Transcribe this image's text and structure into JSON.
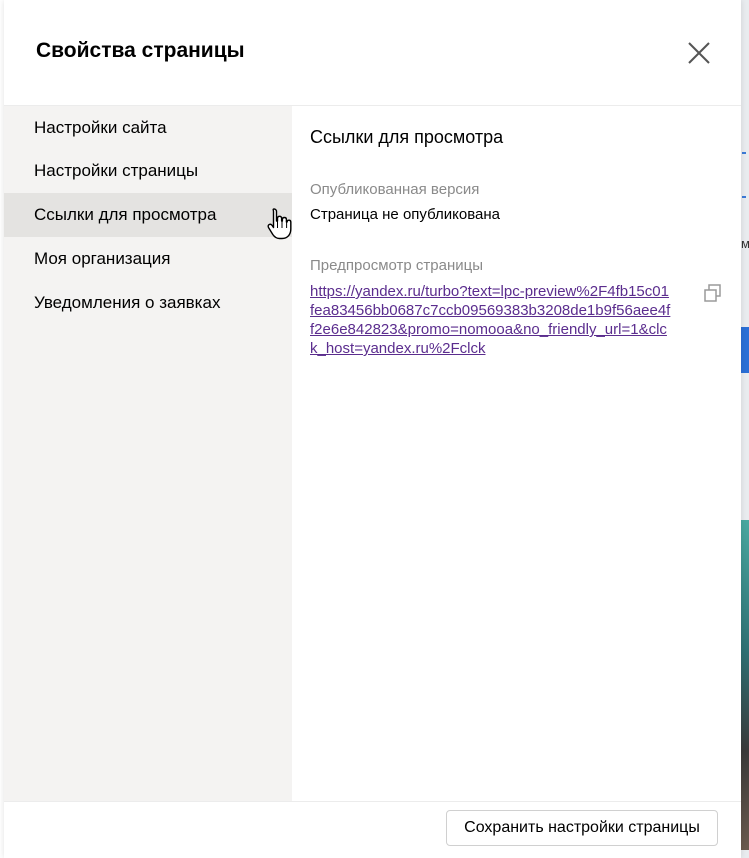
{
  "modal": {
    "title": "Свойства страницы"
  },
  "sidebar": {
    "items": [
      {
        "label": "Настройки сайта"
      },
      {
        "label": "Настройки страницы"
      },
      {
        "label": "Ссылки для просмотра",
        "active": true
      },
      {
        "label": "Моя организация"
      },
      {
        "label": "Уведомления о заявках"
      }
    ]
  },
  "content": {
    "section_title": "Ссылки для просмотра",
    "published": {
      "label": "Опубликованная версия",
      "value": "Страница не опубликована"
    },
    "preview": {
      "label": "Предпросмотр страницы",
      "url": "https://yandex.ru/turbo?text=lpc-preview%2F4fb15c01fea83456bb0687c7ccb09569383b3208de1b9f56aee4ff2e6e842823&promo=nomooa&no_friendly_url=1&clck_host=yandex.ru%2Fclck"
    }
  },
  "footer": {
    "save_label": "Сохранить настройки страницы"
  },
  "icons": {
    "close": "close-icon",
    "copy": "copy-icon",
    "cursor": "hand-pointer-cursor-icon"
  },
  "colors": {
    "sidebar_bg": "#f4f3f2",
    "sidebar_active_bg": "#e4e3e1",
    "link": "#5b2d8e",
    "muted_label": "#8a8a8a"
  }
}
